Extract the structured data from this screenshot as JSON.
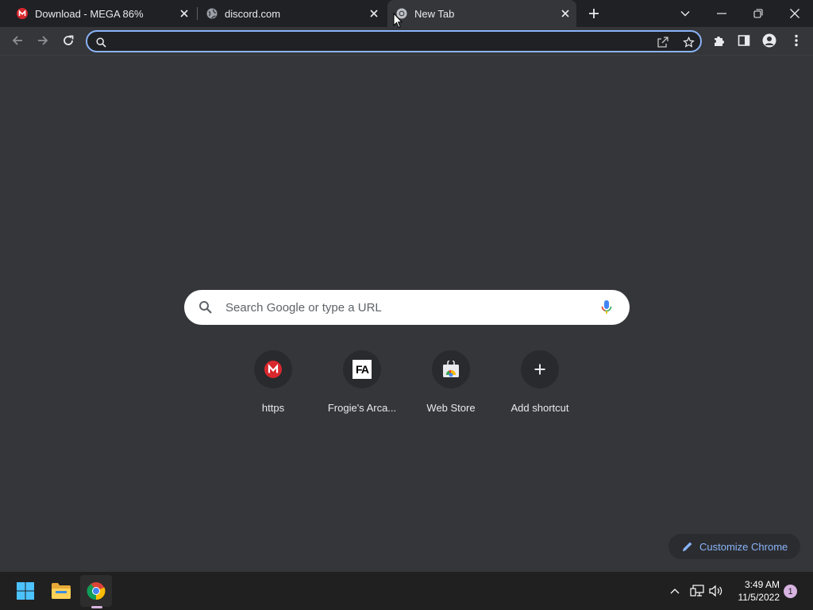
{
  "tabs": [
    {
      "title": "Download - MEGA 86%",
      "favicon": "mega-icon",
      "active": false
    },
    {
      "title": "discord.com",
      "favicon": "globe-icon",
      "active": false
    },
    {
      "title": "New Tab",
      "favicon": "chrome-icon",
      "active": true
    }
  ],
  "omnibox": {
    "value": "",
    "placeholder": ""
  },
  "search": {
    "placeholder": "Search Google or type a URL"
  },
  "shortcuts": [
    {
      "label": "https",
      "icon": "mega-icon"
    },
    {
      "label": "Frogie's Arca...",
      "icon": "fa-text",
      "icon_text": "FA"
    },
    {
      "label": "Web Store",
      "icon": "web-store-icon"
    },
    {
      "label": "Add shortcut",
      "icon": "plus-icon"
    }
  ],
  "customize": {
    "label": "Customize Chrome"
  },
  "taskbar": {
    "time": "3:49 AM",
    "date": "11/5/2022",
    "notification_count": "1"
  },
  "colors": {
    "accent": "#8ab4f8",
    "mega_red": "#d9272e",
    "background": "#35363a",
    "titlebar": "#202124"
  }
}
